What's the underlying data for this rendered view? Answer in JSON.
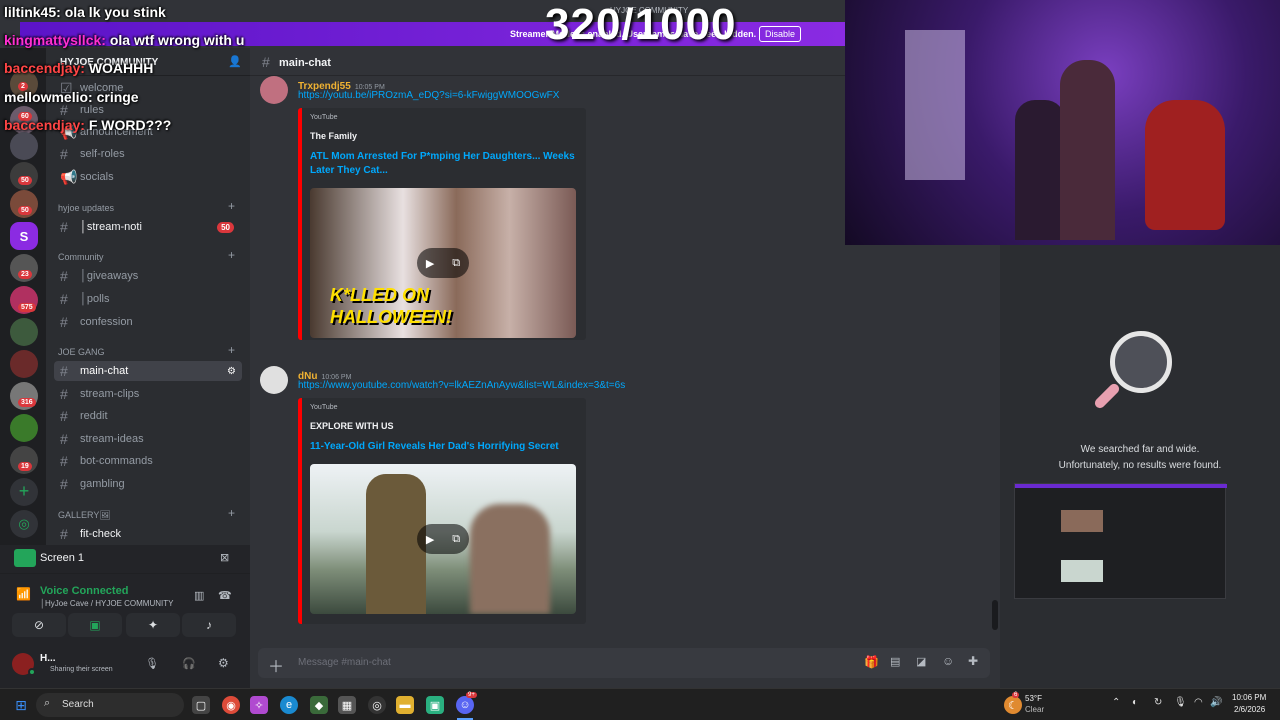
{
  "counter": "320/1000",
  "overlay_chat": [
    {
      "user": "liltink45:",
      "text": "ola lk you stink",
      "color": "white"
    },
    {
      "user": "kingmattysllck:",
      "text": "ola wtf wrong with u",
      "color": "magenta"
    },
    {
      "user": "baccendjay:",
      "text": "WOAHHH",
      "color": "red"
    },
    {
      "user": "mellowmelio:",
      "text": "cringe",
      "color": "white"
    },
    {
      "user": "baccendjay:",
      "text": "F WORD???",
      "color": "red"
    }
  ],
  "streamer_banner": {
    "text": "Streamer Mode is enabled. Usernames have been hidden.",
    "button": "Disable",
    "ghost_title": "HYJOE COMMUNITY"
  },
  "server_rail": {
    "badges": [
      "2",
      "60",
      "50",
      "50",
      "23",
      "575",
      "316",
      "19"
    ]
  },
  "channels": {
    "server_name": "HYJOE COMMUNITY",
    "top": [
      {
        "name": "welcome"
      },
      {
        "name": "rules"
      },
      {
        "name": "announcement"
      },
      {
        "name": "self-roles"
      },
      {
        "name": "socials"
      }
    ],
    "cat_updates": "hyjoe updates",
    "stream_noti": {
      "name": "│stream-noti",
      "badge": "50"
    },
    "cat_community": "Community",
    "community": [
      "│giveaways",
      "│polls",
      "confession"
    ],
    "cat_joegang": "JOE GANG",
    "joegang": [
      "main-chat",
      "stream-clips",
      "reddit",
      "stream-ideas",
      "bot-commands",
      "gambling"
    ],
    "cat_gallery": "GALLERY🖼",
    "gallery": [
      "fit-check"
    ]
  },
  "voice": {
    "screen_label": "Screen 1",
    "status": "Voice Connected",
    "channel": "│HyJoe Cave / HYJOE COMMUNITY",
    "user": "H...",
    "user_status": "Sharing their screen"
  },
  "chat": {
    "channel": "main-chat",
    "messages": [
      {
        "author": "Trxpendj55",
        "time": "10:05 PM",
        "url": "https://youtu.be/iPROzmA_eDQ?si=6-kFwiggWMOOGwFX",
        "provider": "YouTube",
        "embed_author": "The Family",
        "title": "ATL Mom Arrested For P*mping Her Daughters... Weeks Later They Cat...",
        "thumb_text": "K*LLED ON HALLOWEEN!"
      },
      {
        "author": "dNu",
        "time": "10:06 PM",
        "url": "https://www.youtube.com/watch?v=lkAEZnAnAyw&list=WL&index=3&t=6s",
        "provider": "YouTube",
        "embed_author": "EXPLORE WITH US",
        "title": "11-Year-Old Girl Reveals Her Dad's Horrifying Secret"
      }
    ],
    "input_placeholder": "Message #main-chat"
  },
  "search_panel": {
    "line1": "We searched far and wide.",
    "line2": "Unfortunately, no results were found."
  },
  "taskbar": {
    "search": "Search",
    "weather_temp": "53°F",
    "weather_desc": "Clear",
    "weather_badge": "6",
    "time": "10:06 PM",
    "date": "2/6/2026",
    "discord_badge": "9+"
  },
  "colors": {
    "accent_purple": "#a855f7",
    "discord_blurple": "#5865f2",
    "bg_dark": "#1e1f22"
  }
}
